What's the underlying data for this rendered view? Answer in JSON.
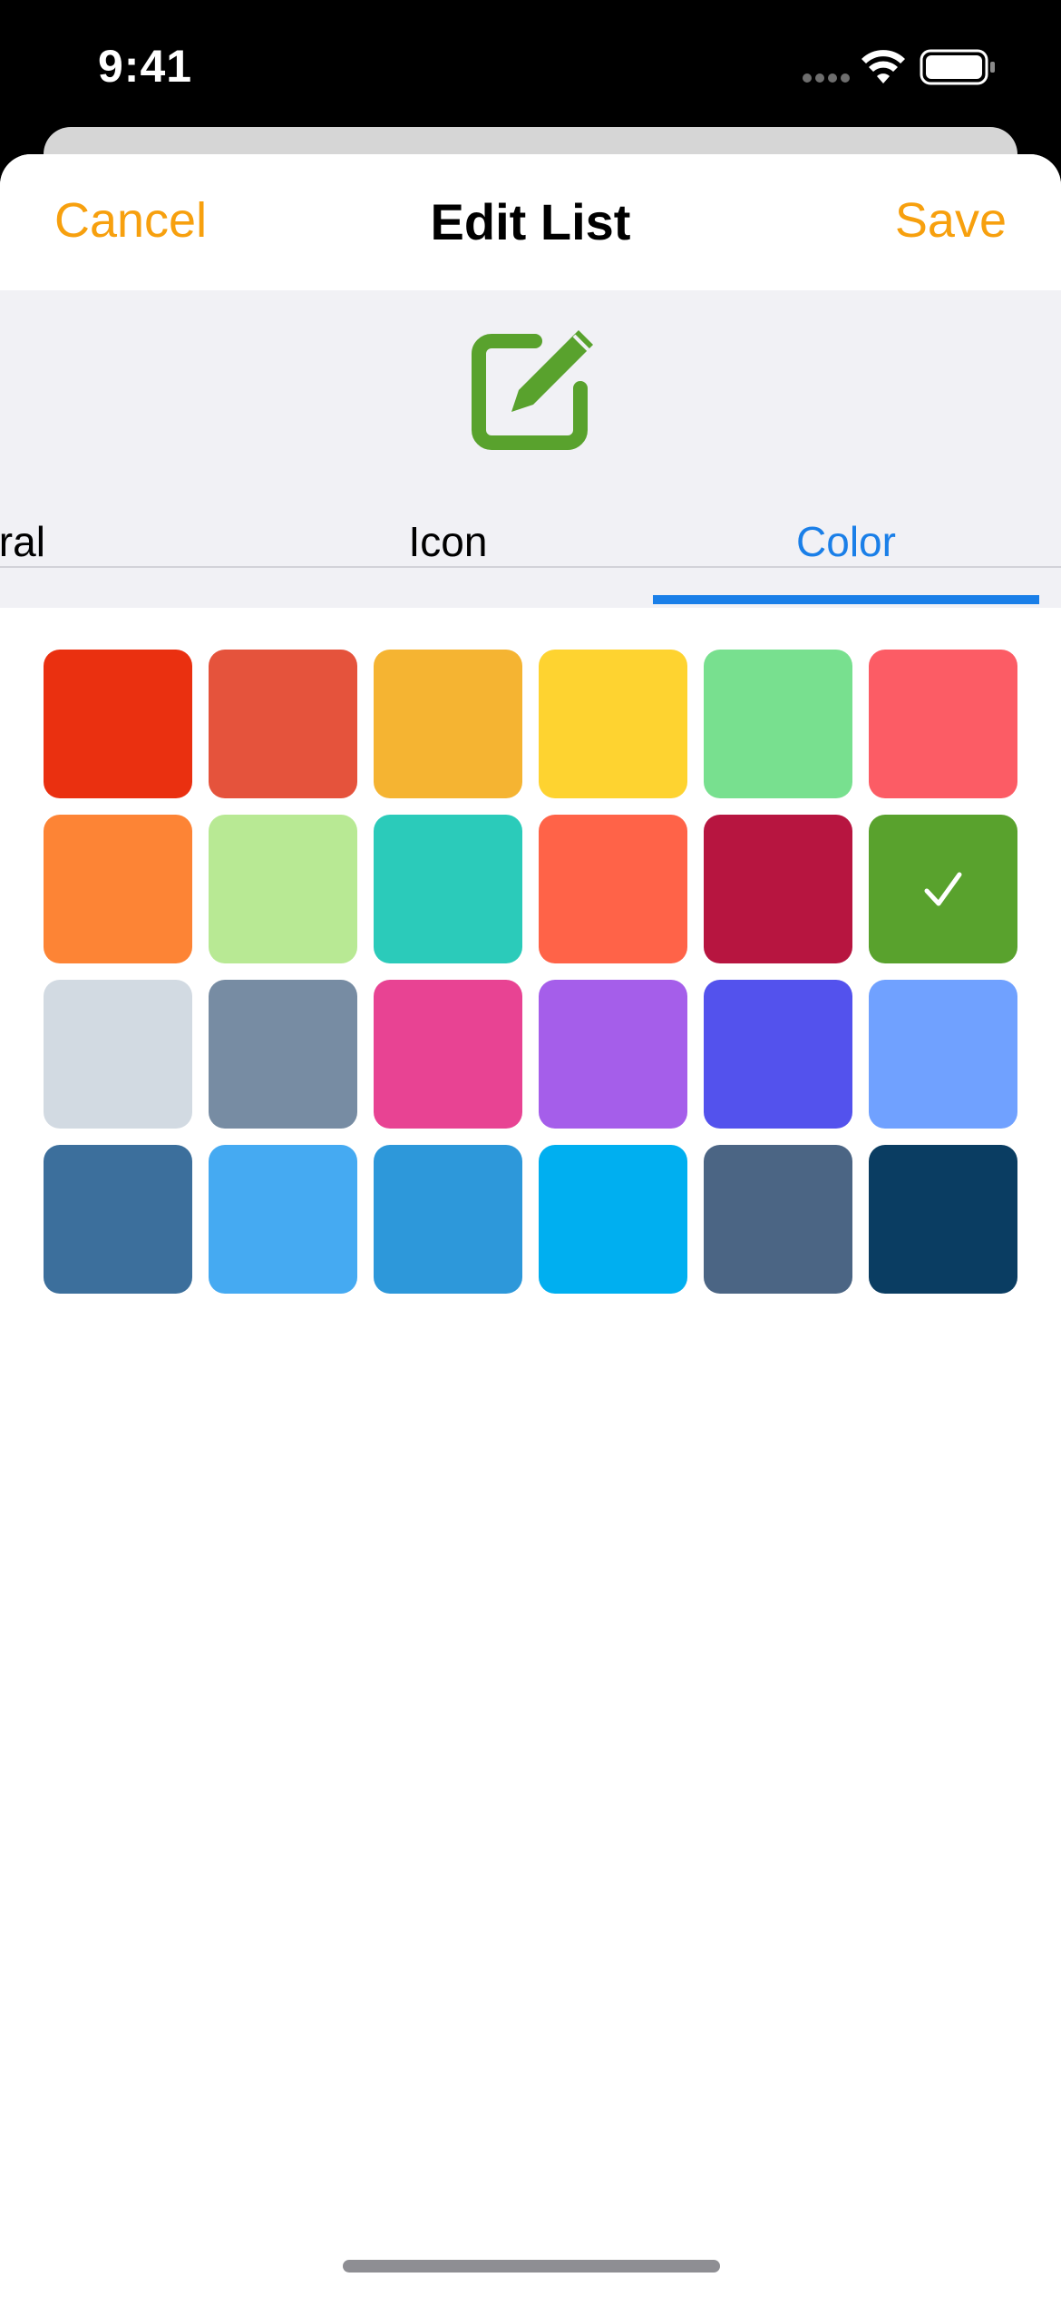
{
  "status_bar": {
    "time": "9:41",
    "icons": [
      "signal-dots-icon",
      "wifi-icon",
      "battery-icon"
    ]
  },
  "nav": {
    "cancel_label": "Cancel",
    "title": "Edit List",
    "save_label": "Save"
  },
  "header": {
    "icon": "edit-square-icon",
    "icon_color": "#59a22d"
  },
  "tabs": [
    {
      "label": "eneral"
    },
    {
      "label": "Icon"
    },
    {
      "label": "Color",
      "selected": true
    }
  ],
  "colors": {
    "accent": "#f7a00e",
    "tab_selected": "#1a7fe8",
    "swatches": [
      "#ea3010",
      "#e5533c",
      "#f5b432",
      "#fed330",
      "#78e08f",
      "#fc5c65",
      "#fd8435",
      "#b8e994",
      "#2bcbba",
      "#ff6348",
      "#b71540",
      "#59a22d",
      "#d2dae2",
      "#778ca3",
      "#e84393",
      "#a55eea",
      "#5352ed",
      "#70a1ff",
      "#3c6f9c",
      "#45aaf2",
      "#2d98da",
      "#00aff0",
      "#4b6584",
      "#0a3d62"
    ],
    "selected_index": 11
  }
}
